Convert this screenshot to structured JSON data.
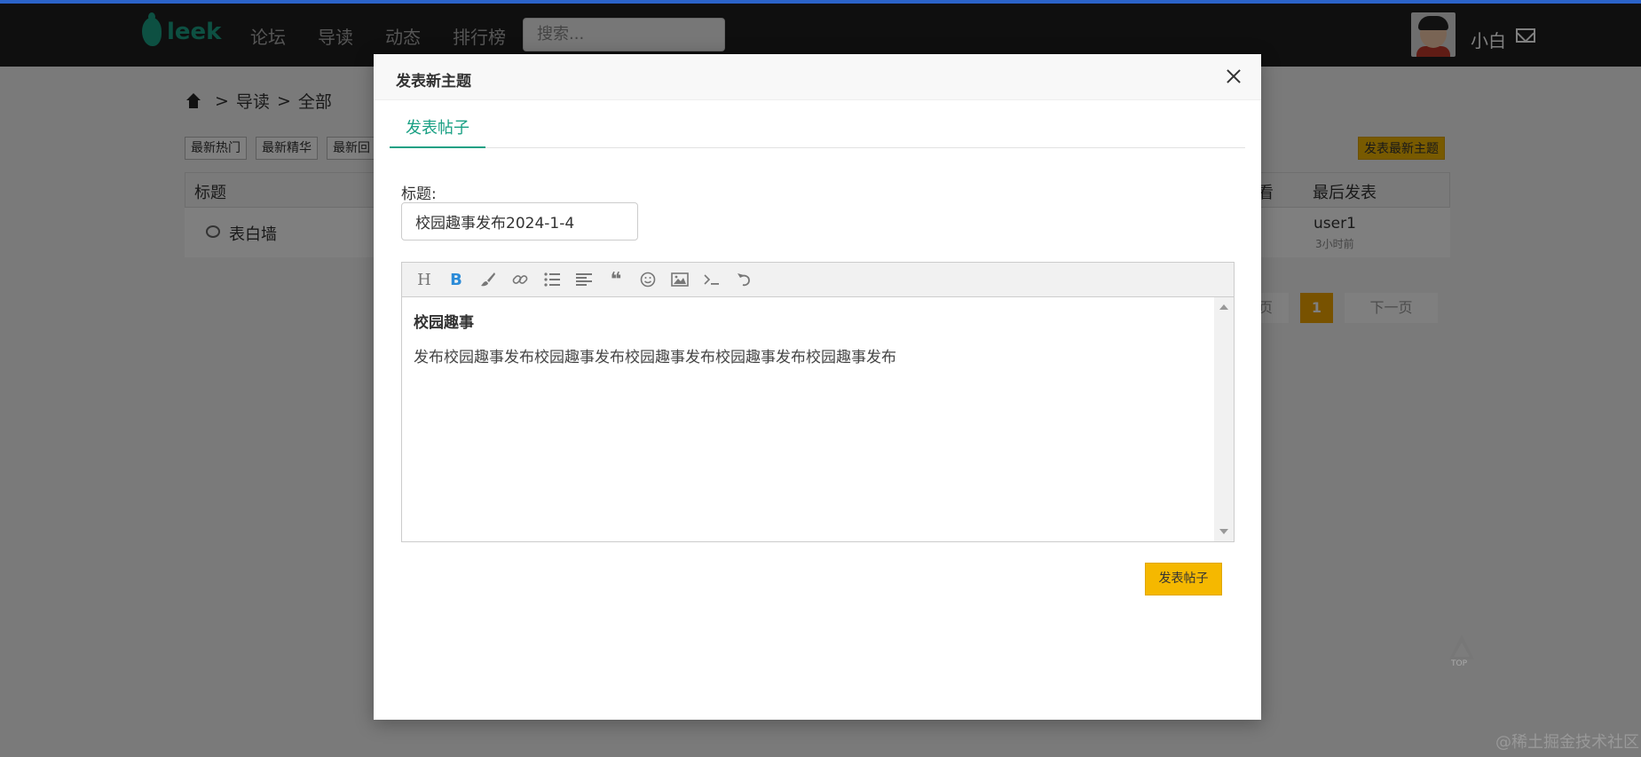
{
  "nav": {
    "logo_text": "leek",
    "items": [
      "论坛",
      "导读",
      "动态",
      "排行榜"
    ],
    "search_placeholder": "搜索...",
    "username": "小白"
  },
  "breadcrumb": {
    "part1": "导读",
    "part2": "全部",
    "sep": ">"
  },
  "filters": [
    "最新热门",
    "最新精华",
    "最新回"
  ],
  "post_new_label": "发表最新主题",
  "table": {
    "col_title": "标题",
    "col_view": "看",
    "col_last": "最后发表",
    "row": {
      "title": "表白墙",
      "user": "user1",
      "time": "3小时前"
    }
  },
  "pager": {
    "current": "1",
    "next": "下一页",
    "prev": "页"
  },
  "top_label": "TOP",
  "watermark": "@稀土掘金技术社区",
  "modal": {
    "title": "发表新主题",
    "tab": "发表帖子",
    "field_label": "标题:",
    "title_value": "校园趣事发布2024-1-4",
    "editor_heading": "校园趣事",
    "editor_text": "发布校园趣事发布校园趣事发布校园趣事发布校园趣事发布校园趣事发布",
    "submit_label": "发表帖子"
  },
  "colors": {
    "accent": "#1aa084",
    "button": "#f5b800",
    "nav_bg": "#1e1e1e"
  }
}
